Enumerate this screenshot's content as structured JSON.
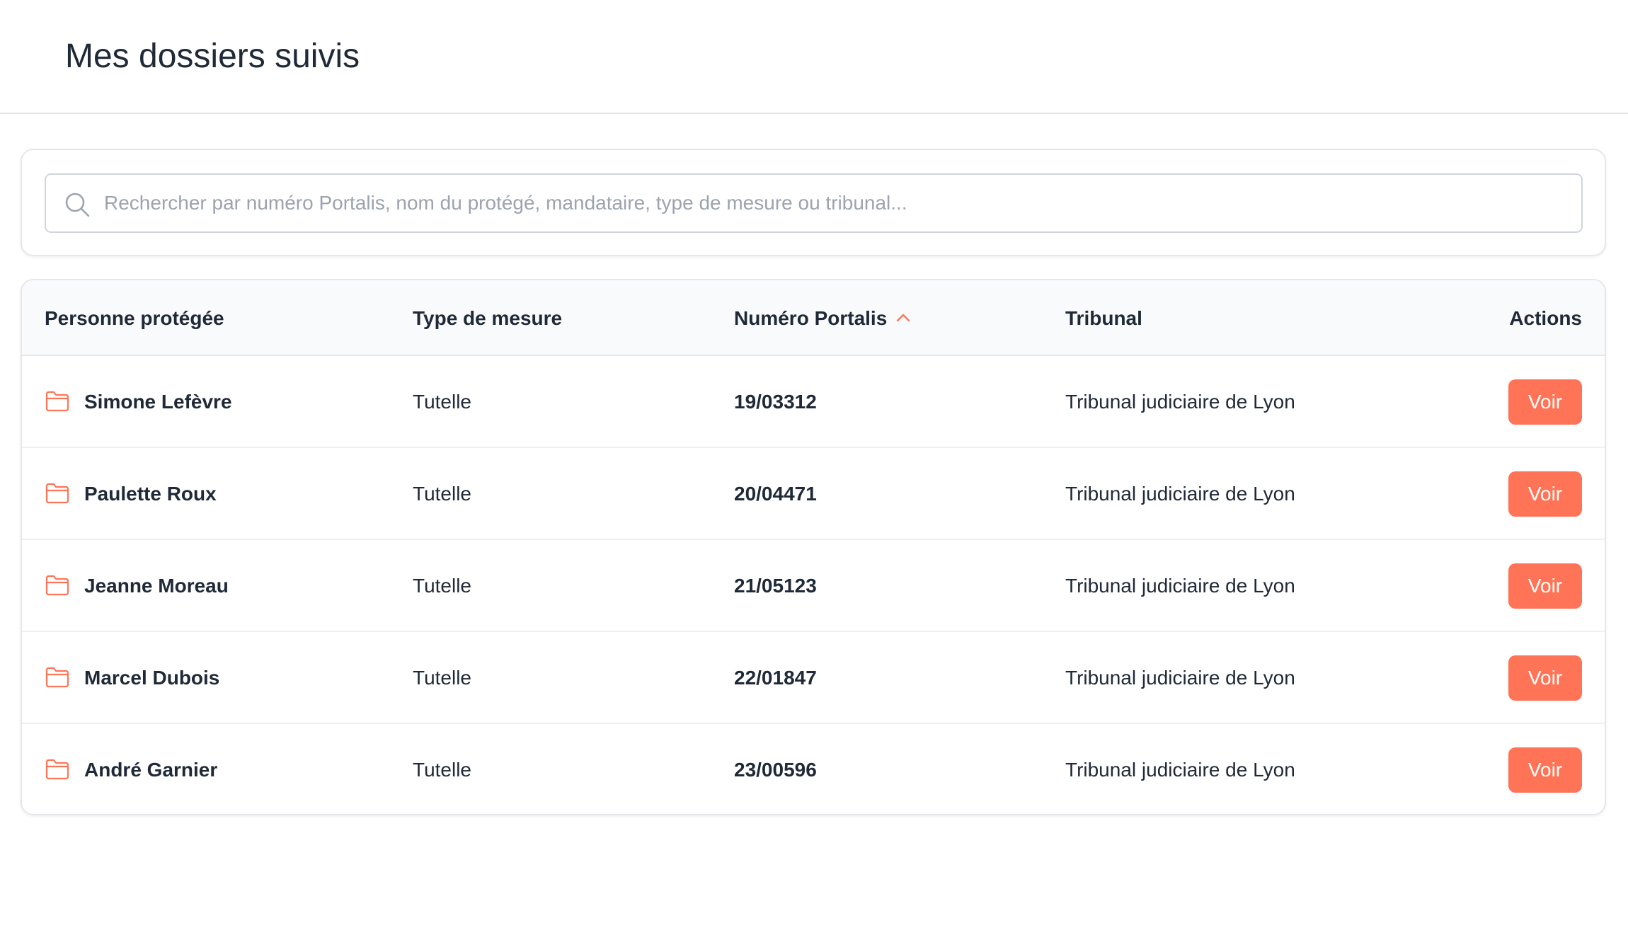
{
  "header": {
    "title": "Mes dossiers suivis"
  },
  "search": {
    "placeholder": "Rechercher par numéro Portalis, nom du protégé, mandataire, type de mesure ou tribunal...",
    "value": "",
    "icon": "search-icon"
  },
  "table": {
    "columns": {
      "person": "Personne protégée",
      "type": "Type de mesure",
      "numero": "Numéro Portalis",
      "tribunal": "Tribunal",
      "actions": "Actions"
    },
    "sort": {
      "column": "numero",
      "direction": "ascending",
      "icon": "chevron-up-icon"
    },
    "rows": [
      {
        "person": "Simone Lefèvre",
        "type": "Tutelle",
        "numero": "19/03312",
        "tribunal": "Tribunal judiciaire de Lyon",
        "action": "Voir"
      },
      {
        "person": "Paulette Roux",
        "type": "Tutelle",
        "numero": "20/04471",
        "tribunal": "Tribunal judiciaire de Lyon",
        "action": "Voir"
      },
      {
        "person": "Jeanne Moreau",
        "type": "Tutelle",
        "numero": "21/05123",
        "tribunal": "Tribunal judiciaire de Lyon",
        "action": "Voir"
      },
      {
        "person": "Marcel Dubois",
        "type": "Tutelle",
        "numero": "22/01847",
        "tribunal": "Tribunal judiciaire de Lyon",
        "action": "Voir"
      },
      {
        "person": "André Garnier",
        "type": "Tutelle",
        "numero": "23/00596",
        "tribunal": "Tribunal judiciaire de Lyon",
        "action": "Voir"
      }
    ]
  },
  "colors": {
    "accent": "#ff7456",
    "text": "#1f2937",
    "border": "#e5e7eb",
    "header_bg": "#f9fafb",
    "placeholder": "#9ca3af"
  }
}
